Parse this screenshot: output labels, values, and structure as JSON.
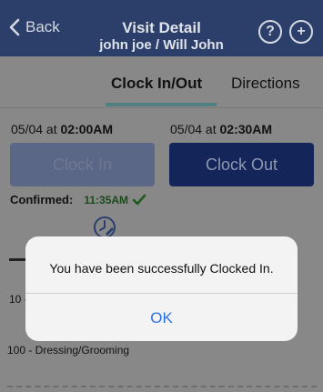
{
  "header": {
    "back_label": "Back",
    "title": "Visit Detail",
    "subtitle": "john joe / Will John",
    "help_glyph": "?",
    "add_glyph": "+"
  },
  "tabs": [
    {
      "label": "Clock In/Out",
      "active": true
    },
    {
      "label": "Directions",
      "active": false
    }
  ],
  "clock": {
    "in_date": "05/04 at ",
    "in_time": "02:00AM",
    "out_date": "05/04 at ",
    "out_time": "02:30AM",
    "clock_in_label": "Clock In",
    "clock_out_label": "Clock Out",
    "confirmed_label": "Confirmed:",
    "confirmed_time": "11:35AM"
  },
  "tasks": [
    {
      "label": "10 -"
    },
    {
      "label": "100 - Dressing/Grooming"
    }
  ],
  "alert": {
    "message": "You have been successfully Clocked In.",
    "ok_label": "OK"
  },
  "colors": {
    "nav_bg": "#2b3f6a",
    "clock_out_bg": "#14255a",
    "confirmed_green": "#1b4a1b",
    "ok_blue": "#2d6fe5"
  },
  "icons": {
    "back": "chevron-left-icon",
    "help": "help-icon",
    "add": "add-icon",
    "check": "check-icon",
    "clock": "clock-edit-icon"
  }
}
